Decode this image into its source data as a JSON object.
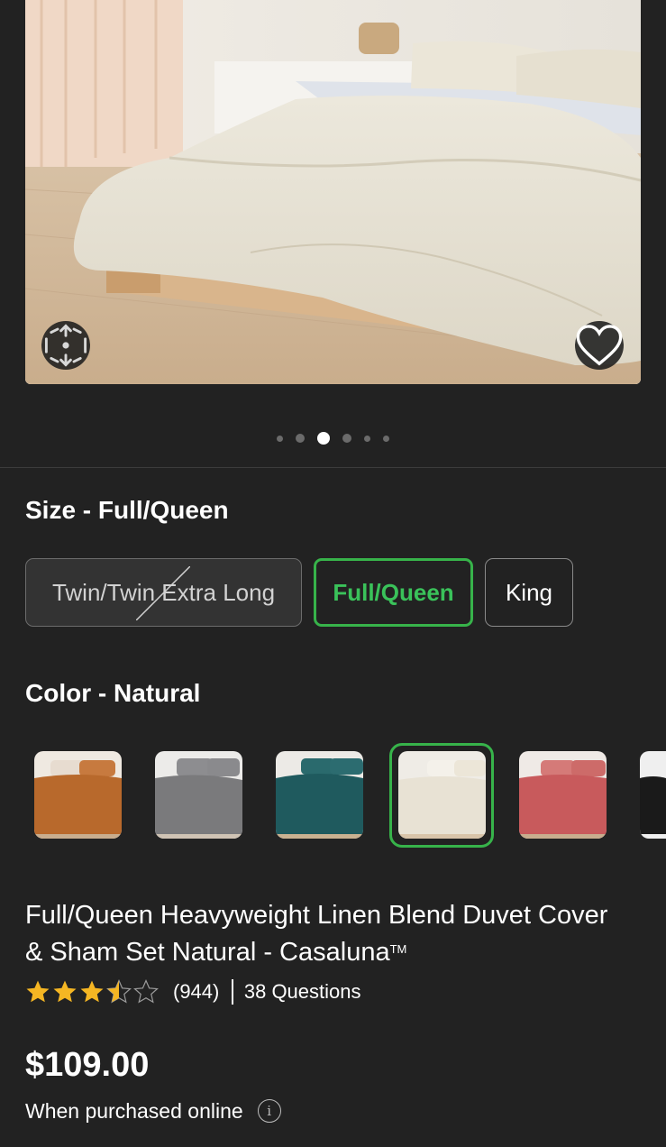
{
  "size": {
    "heading": "Size - Full/Queen",
    "options": [
      {
        "label": "Twin/Twin Extra Long",
        "state": "unavailable"
      },
      {
        "label": "Full/Queen",
        "state": "selected"
      },
      {
        "label": "King",
        "state": "available"
      }
    ]
  },
  "color": {
    "heading": "Color - Natural",
    "swatches": [
      {
        "name": "rust",
        "hex": "#b8692c"
      },
      {
        "name": "gray",
        "hex": "#7a7a7c"
      },
      {
        "name": "teal",
        "hex": "#1f5a5e"
      },
      {
        "name": "natural",
        "hex": "#e8e2d4",
        "selected": true
      },
      {
        "name": "rose",
        "hex": "#c85a5c"
      },
      {
        "name": "black",
        "hex": "#1a1a1a"
      }
    ]
  },
  "gallery": {
    "dot_count": 6,
    "active_index": 2
  },
  "product": {
    "title": "Full/Queen Heavyweight Linen Blend Duvet Cover & Sham Set Natural - Casaluna",
    "trademark": "TM",
    "rating": 3.5,
    "rating_max": 5,
    "review_count": "(944)",
    "questions": "38 Questions",
    "price": "$109.00",
    "price_note": "When purchased online"
  },
  "icons": {
    "ar": "ar-view-icon",
    "favorite": "heart-icon",
    "info": "info-icon",
    "star": "star-icon"
  },
  "colors": {
    "background": "#222222",
    "accent_green": "#37b34a",
    "star_gold": "#f5b623"
  }
}
